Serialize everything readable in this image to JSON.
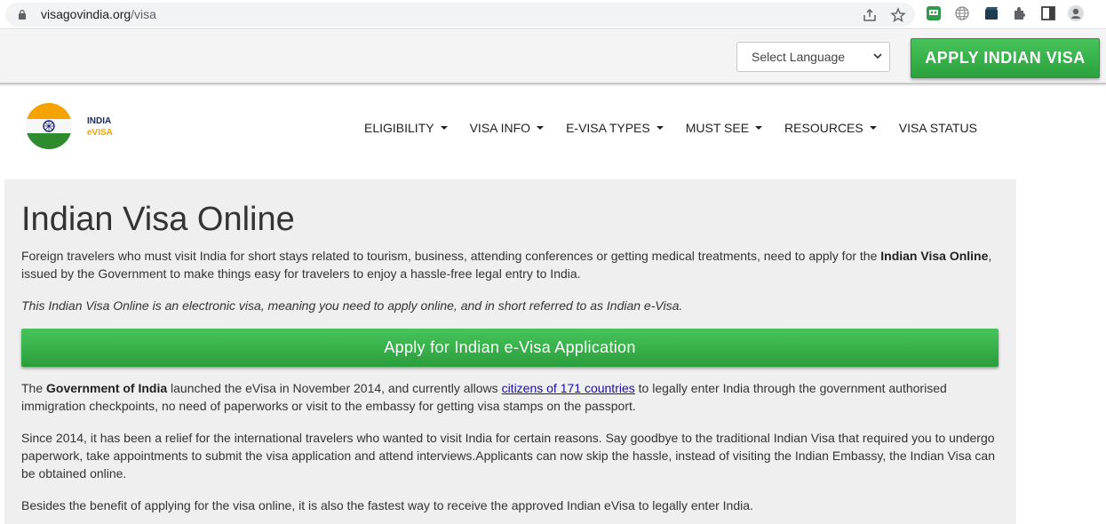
{
  "browser": {
    "url_domain": "visagovindia.org",
    "url_path": "/visa"
  },
  "topbar": {
    "language_select": "Select Language",
    "apply_button": "APPLY INDIAN VISA"
  },
  "logo": {
    "line1": "INDIA",
    "line2": "eVISA"
  },
  "nav": {
    "items": [
      {
        "label": "ELIGIBILITY"
      },
      {
        "label": "VISA INFO"
      },
      {
        "label": "E-VISA TYPES"
      },
      {
        "label": "MUST SEE"
      },
      {
        "label": "RESOURCES"
      },
      {
        "label": "VISA STATUS"
      }
    ]
  },
  "main": {
    "title": "Indian Visa Online",
    "para1_a": "Foreign travelers who must visit India for short stays related to tourism, business, attending conferences or getting medical treatments, need to apply for the ",
    "para1_bold": "Indian Visa Online",
    "para1_b": ", issued by the Government to make things easy for travelers to enjoy a hassle-free legal entry to India.",
    "para2_italic": "This Indian Visa Online is an electronic visa, meaning you need to apply online, and in short referred to as Indian e-Visa.",
    "apply_button": "Apply for Indian e-Visa Application",
    "para3_a": "The ",
    "para3_bold": "Government of India",
    "para3_b": " launched the eVisa in November 2014, and currently allows ",
    "para3_link": "citizens of 171 countries",
    "para3_c": " to legally enter India through the government authorised immigration checkpoints, no need of paperworks or visit to the embassy for getting visa stamps on the passport.",
    "para4": "Since 2014, it has been a relief for the international travelers who wanted to visit India for certain reasons. Say goodbye to the traditional Indian Visa that required you to undergo paperwork, take appointments to submit the visa application and attend interviews.Applicants can now skip the hassle, instead of visiting the Indian Embassy, the Indian Visa can be obtained online.",
    "para5": "Besides the benefit of applying for the visa online, it is also the fastest way to receive the approved Indian eVisa to legally enter India."
  },
  "colors": {
    "accent_green": "#34b248",
    "saffron": "#f4a300",
    "india_green": "#2e8b2e"
  }
}
